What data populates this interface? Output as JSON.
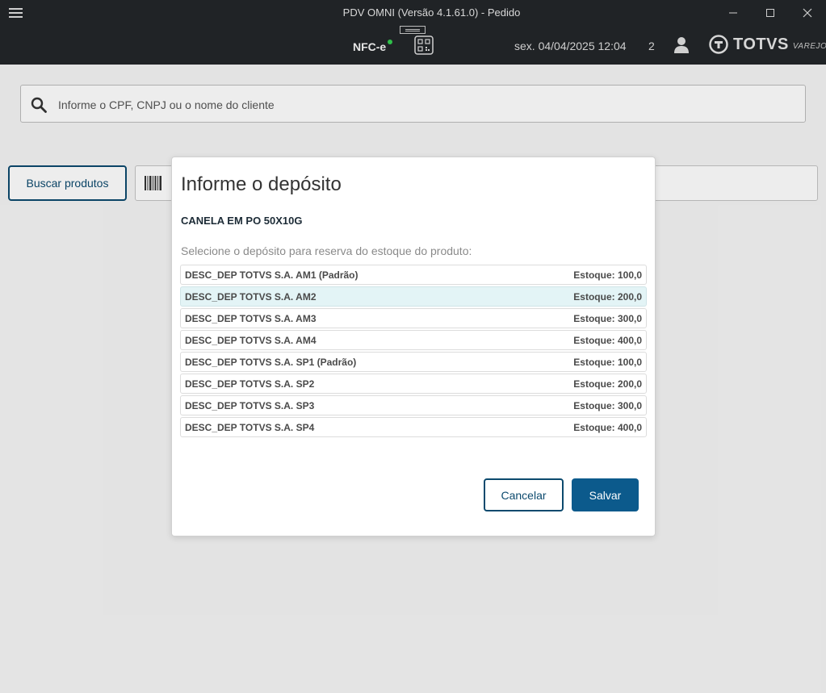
{
  "window": {
    "title": "PDV OMNI (Versão 4.1.61.0) - Pedido"
  },
  "header": {
    "nfce_label": "NFC-e",
    "datetime": "sex. 04/04/2025 12:04",
    "count": "2",
    "brand_name": "TOTVS",
    "brand_sub": "VAREJO",
    "status_dot_color": "#2fbf4a"
  },
  "client_search": {
    "placeholder": "Informe o CPF, CNPJ ou o nome do cliente"
  },
  "products": {
    "search_button": "Buscar produtos"
  },
  "modal": {
    "title": "Informe o depósito",
    "product_name": "CANELA EM PO 50X10G",
    "instruction": "Selecione o depósito para reserva do estoque do produto:",
    "deposits": [
      {
        "name": "DESC_DEP TOTVS S.A. AM1 (Padrão)",
        "stock": "Estoque: 100,0"
      },
      {
        "name": "DESC_DEP TOTVS S.A. AM2",
        "stock": "Estoque: 200,0"
      },
      {
        "name": "DESC_DEP TOTVS S.A. AM3",
        "stock": "Estoque: 300,0"
      },
      {
        "name": "DESC_DEP TOTVS S.A. AM4",
        "stock": "Estoque: 400,0"
      },
      {
        "name": "DESC_DEP TOTVS S.A. SP1 (Padrão)",
        "stock": "Estoque: 100,0"
      },
      {
        "name": "DESC_DEP TOTVS S.A. SP2",
        "stock": "Estoque: 200,0"
      },
      {
        "name": "DESC_DEP TOTVS S.A. SP3",
        "stock": "Estoque: 300,0"
      },
      {
        "name": "DESC_DEP TOTVS S.A. SP4",
        "stock": "Estoque: 400,0"
      }
    ],
    "selected_index": 1,
    "cancel_label": "Cancelar",
    "save_label": "Salvar"
  },
  "colors": {
    "primary": "#0c5a8c",
    "selected_row": "#e3f4f6",
    "topbar": "#202326"
  }
}
